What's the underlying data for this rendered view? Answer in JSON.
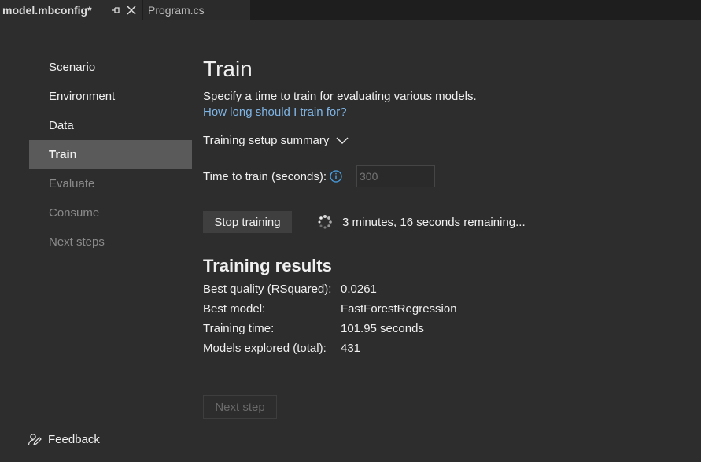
{
  "tabs": [
    {
      "title": "model.mbconfig*",
      "active": true
    },
    {
      "title": "Program.cs",
      "active": false
    }
  ],
  "nav": {
    "items": [
      {
        "label": "Scenario",
        "state": "normal"
      },
      {
        "label": "Environment",
        "state": "normal"
      },
      {
        "label": "Data",
        "state": "normal"
      },
      {
        "label": "Train",
        "state": "active"
      },
      {
        "label": "Evaluate",
        "state": "disabled"
      },
      {
        "label": "Consume",
        "state": "disabled"
      },
      {
        "label": "Next steps",
        "state": "disabled"
      }
    ],
    "feedback_label": "Feedback"
  },
  "main": {
    "title": "Train",
    "subtitle": "Specify a time to train for evaluating various models.",
    "help_link": "How long should I train for?",
    "summary_toggle": "Training setup summary",
    "time_label": "Time to train (seconds):",
    "time_placeholder": "300",
    "stop_label": "Stop training",
    "status": "3 minutes, 16 seconds remaining...",
    "results_title": "Training results",
    "results": [
      {
        "label": "Best quality (RSquared):",
        "value": "0.0261"
      },
      {
        "label": "Best model:",
        "value": "FastForestRegression"
      },
      {
        "label": "Training time:",
        "value": "101.95 seconds"
      },
      {
        "label": "Models explored (total):",
        "value": "431"
      }
    ],
    "next_label": "Next step"
  },
  "colors": {
    "background": "#2d2d2d",
    "tabstrip": "#1e1e1e",
    "nav_active": "#5a5a5a",
    "link": "#7fb5e6",
    "info_icon": "#4aa3e8",
    "disabled_text": "#8a8a8a"
  },
  "icons": {
    "pin": "pin-icon",
    "close": "close-icon",
    "chevron": "chevron-down-icon",
    "info": "info-icon",
    "spinner": "spinner-icon",
    "feedback": "feedback-icon"
  }
}
